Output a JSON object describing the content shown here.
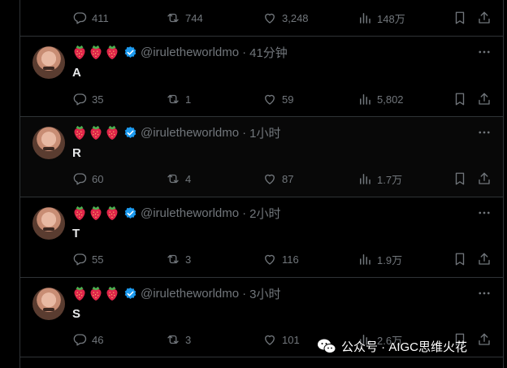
{
  "top_actions": {
    "replies": "411",
    "retweets": "744",
    "likes": "3,248",
    "views": "148万"
  },
  "tweets": [
    {
      "emojis": [
        "strawberry",
        "strawberry",
        "strawberry"
      ],
      "handle": "@iruletheworldmo",
      "separator": "·",
      "time": "41分钟",
      "text": "A",
      "replies": "35",
      "retweets": "1",
      "likes": "59",
      "views": "5,802"
    },
    {
      "emojis": [
        "strawberry",
        "strawberry",
        "strawberry"
      ],
      "handle": "@iruletheworldmo",
      "separator": "·",
      "time": "1小时",
      "text": "R",
      "replies": "60",
      "retweets": "4",
      "likes": "87",
      "views": "1.7万"
    },
    {
      "emojis": [
        "strawberry",
        "strawberry",
        "strawberry"
      ],
      "handle": "@iruletheworldmo",
      "separator": "·",
      "time": "2小时",
      "text": "T",
      "replies": "55",
      "retweets": "3",
      "likes": "116",
      "views": "1.9万"
    },
    {
      "emojis": [
        "strawberry",
        "strawberry",
        "strawberry"
      ],
      "handle": "@iruletheworldmo",
      "separator": "·",
      "time": "3小时",
      "text": "S",
      "replies": "46",
      "retweets": "3",
      "likes": "101",
      "views": "2.6万"
    }
  ],
  "watermark": {
    "text": "公众号 · AIGC思维火花",
    "icon": "wechat-icon"
  },
  "colors": {
    "background": "#000000",
    "border": "#2f3336",
    "muted": "#71767b",
    "verified": "#1d9bf0",
    "text": "#e7e9ea"
  },
  "icons": [
    "reply-icon",
    "retweet-icon",
    "like-icon",
    "views-icon",
    "bookmark-icon",
    "share-icon",
    "more-icon",
    "strawberry-icon",
    "verified-badge-icon"
  ]
}
